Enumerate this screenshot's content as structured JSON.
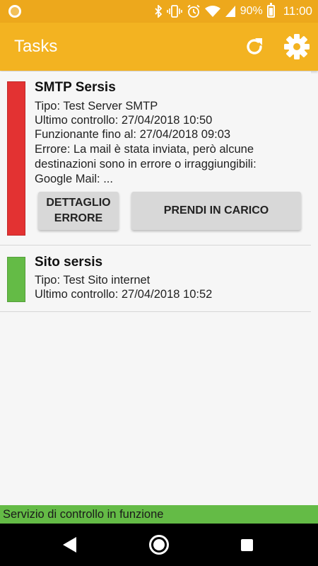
{
  "status_bar": {
    "battery_percent": "90%",
    "time": "11:00",
    "icons": [
      "notification-circle-icon",
      "bluetooth-icon",
      "vibrate-icon",
      "alarm-icon",
      "wifi-icon",
      "cell-signal-icon",
      "battery-icon"
    ]
  },
  "app_bar": {
    "title": "Tasks",
    "actions": [
      "refresh-icon",
      "settings-icon"
    ]
  },
  "tasks": [
    {
      "title": "SMTP Sersis",
      "status_color": "#e33232",
      "tipo": "Tipo: Test Server SMTP",
      "ultimo_controllo": "Ultimo controllo: 27/04/2018 10:50",
      "funzionante": "Funzionante fino al: 27/04/2018 09:03",
      "errore": "Errore: La mail è stata inviata, però alcune destinazioni sono in errore o irraggiungibili: Google Mail: ...",
      "buttons": {
        "detail": "DETTAGLIO ERRORE",
        "take_charge": "PRENDI IN CARICO"
      }
    },
    {
      "title": "Sito sersis",
      "status_color": "#64bb46",
      "tipo": "Tipo: Test Sito internet",
      "ultimo_controllo": "Ultimo controllo: 27/04/2018 10:52"
    }
  ],
  "service_status": "Servizio di controllo in funzione",
  "colors": {
    "status_bar": "#eda81c",
    "app_bar": "#f3b321",
    "error": "#e33232",
    "ok": "#64bb46"
  },
  "nav_bar": [
    "back-icon",
    "home-icon",
    "recent-apps-icon"
  ]
}
